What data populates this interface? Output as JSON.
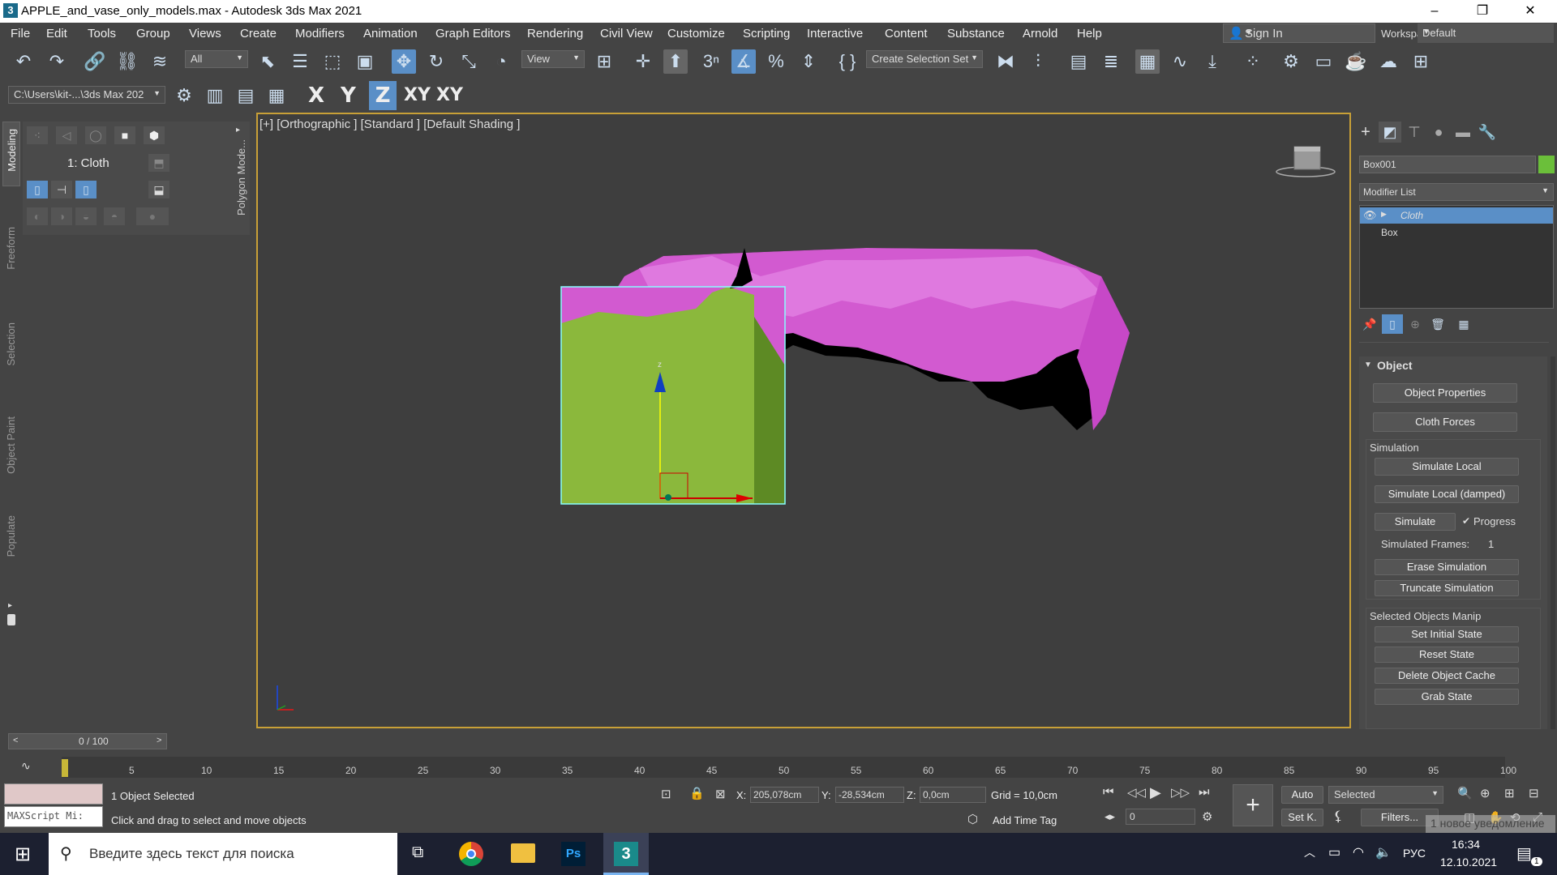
{
  "window": {
    "title": "APPLE_and_vase_only_models.max - Autodesk 3ds Max 2021",
    "app_icon": "3",
    "controls": [
      "–",
      "❐",
      "✕"
    ]
  },
  "menubar": {
    "items": [
      "File",
      "Edit",
      "Tools",
      "Group",
      "Views",
      "Create",
      "Modifiers",
      "Animation",
      "Graph Editors",
      "Rendering",
      "Civil View",
      "Customize",
      "Scripting",
      "Interactive",
      "Content",
      "Substance",
      "Arnold",
      "Help"
    ],
    "sign_in": "Sign In",
    "workspaces_label": "Workspaces:",
    "workspaces_value": "Default"
  },
  "toolbar": {
    "filter_value": "All",
    "ref_coord_value": "View",
    "selection_set_value": "Create Selection Set",
    "path_value": "C:\\Users\\kit-...\\3ds Max 202",
    "axes": [
      "X",
      "Y",
      "Z",
      "XY",
      "XY"
    ]
  },
  "left_tabs": [
    "Modeling",
    "Freeform",
    "Selection",
    "Object Paint",
    "Populate"
  ],
  "modeling_panel": {
    "label": "1: Cloth",
    "side_label": "Polygon Mode..."
  },
  "viewport": {
    "label": "[+] [Orthographic ] [Standard ] [Default Shading ]",
    "gizmo_axis_z": "z"
  },
  "command_panel": {
    "object_name": "Box001",
    "name_color": "#6bbf3a",
    "modifier_list": "Modifier List",
    "stack": [
      "Cloth",
      "Box"
    ],
    "object_section": "Object",
    "buttons_top": [
      "Object Properties",
      "Cloth Forces"
    ],
    "simulation_label": "Simulation",
    "simulation_buttons": [
      "Simulate Local",
      "Simulate Local (damped)",
      "Simulate"
    ],
    "progress_label": "Progress",
    "progress_checked": true,
    "simulated_frames_label": "Simulated Frames:",
    "simulated_frames_value": "1",
    "sim_more_buttons": [
      "Erase Simulation",
      "Truncate Simulation"
    ],
    "selected_objects_label": "Selected Objects Manip",
    "manip_buttons": [
      "Set Initial State",
      "Reset State",
      "Delete Object Cache",
      "Grab State"
    ]
  },
  "timeline": {
    "frame_display": "0 / 100",
    "ticks": [
      "5",
      "10",
      "15",
      "20",
      "25",
      "30",
      "35",
      "40",
      "45",
      "50",
      "55",
      "60",
      "65",
      "70",
      "75",
      "80",
      "85",
      "90",
      "95",
      "100"
    ]
  },
  "status": {
    "maxscript": "MAXScript Mi:",
    "selected": "1 Object Selected",
    "prompt": "Click and drag to select and move objects",
    "x_label": "X:",
    "x_value": "205,078cm",
    "y_label": "Y:",
    "y_value": "-28,534cm",
    "z_label": "Z:",
    "z_value": "0,0cm",
    "grid": "Grid = 10,0cm",
    "add_time_tag": "Add Time Tag",
    "auto": "Auto",
    "set_key": "Set K.",
    "selected_dropdown": "Selected",
    "frame_field": "0",
    "filters": "Filters...",
    "notification": "1 новое уведомление"
  },
  "taskbar": {
    "search_placeholder": "Введите здесь текст для поиска",
    "lang": "РУС",
    "time": "16:34",
    "date": "12.10.2021",
    "notif_count": "1"
  }
}
